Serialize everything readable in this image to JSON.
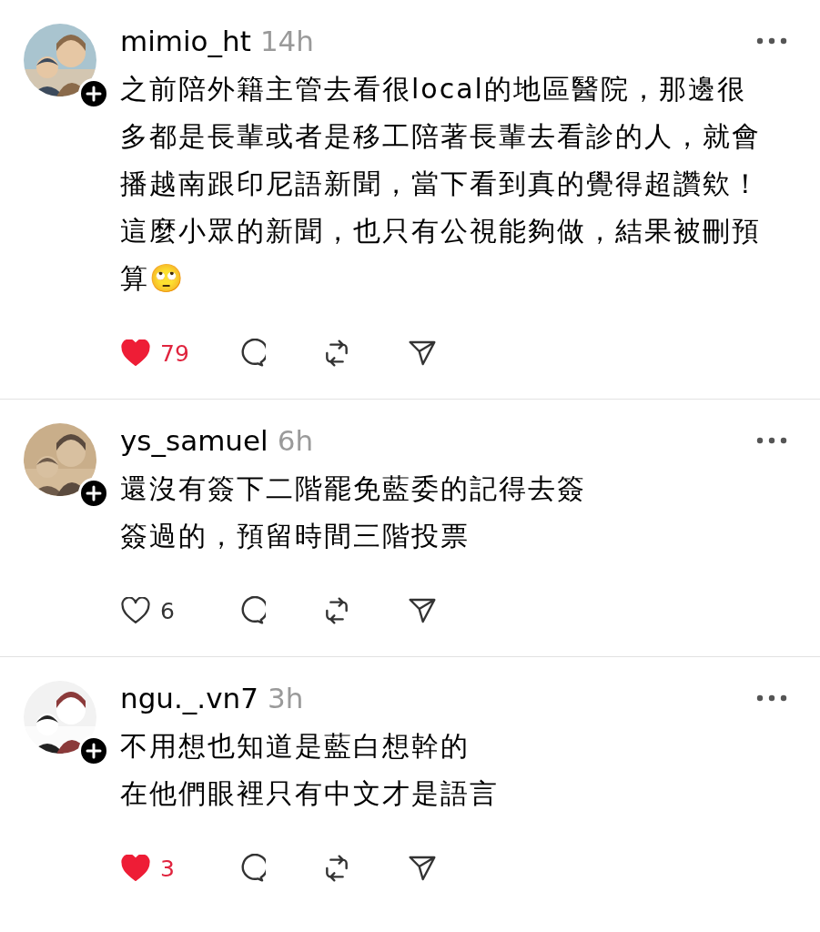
{
  "posts": [
    {
      "username": "mimio_ht",
      "time": "14h",
      "avatar": {
        "kind": "picture"
      },
      "lines": [
        "之前陪外籍主管去看很local的地區醫院，那邊很",
        "多都是長輩或者是移工陪著長輩去看診的人，就會",
        "播越南跟印尼語新聞，當下看到真的覺得超讚欸！",
        "這麼小眾的新聞，也只有公視能夠做，結果被刪預",
        "算🙄"
      ],
      "liked": true,
      "likes": "79"
    },
    {
      "username": "ys_samuel",
      "time": "6h",
      "avatar": {
        "kind": "picture"
      },
      "lines": [
        "還沒有簽下二階罷免藍委的記得去簽",
        "簽過的，預留時間三階投票"
      ],
      "liked": false,
      "likes": "6"
    },
    {
      "username": "ngu._.vn7",
      "time": "3h",
      "avatar": {
        "kind": "picture"
      },
      "lines": [
        "不用想也知道是藍白想幹的",
        "在他們眼裡只有中文才是語言"
      ],
      "liked": true,
      "likes": "3"
    }
  ]
}
